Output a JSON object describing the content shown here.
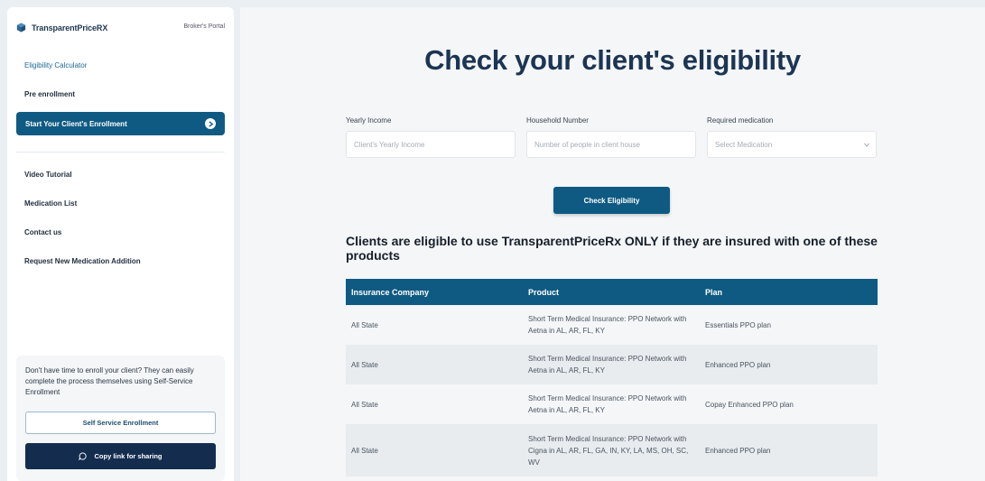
{
  "sidebar": {
    "brand_name": "TransparentPriceRX",
    "portal_label": "Broker's Portal",
    "nav": {
      "eligibility_calculator": "Eligibility Calculator",
      "pre_enrollment": "Pre enrollment",
      "start_enrollment": "Start Your Client's Enrollment",
      "video_tutorial": "Video Tutorial",
      "medication_list": "Medication List",
      "contact_us": "Contact us",
      "request_medication": "Request New Medication Addition"
    },
    "promo": {
      "text": "Don't have time to enroll your client? They can easily complete the process themselves using Self-Service Enrollment",
      "self_service_button": "Self Service Enrollment",
      "copy_link_button": "Copy link for sharing"
    }
  },
  "main": {
    "title": "Check your client's eligibility",
    "fields": {
      "income_label": "Yearly Income",
      "income_placeholder": "Client's Yearly Income",
      "household_label": "Household Number",
      "household_placeholder": "Number of people in client house",
      "medication_label": "Required medication",
      "medication_placeholder": "Select Medication"
    },
    "check_button": "Check Eligibility",
    "note": "Clients are eligible to use TransparentPriceRx ONLY if they are insured with one of these products",
    "table": {
      "headers": [
        "Insurance Company",
        "Product",
        "Plan"
      ],
      "rows": [
        {
          "company": "All State",
          "product": "Short Term Medical Insurance: PPO Network with Aetna in AL, AR, FL, KY",
          "plan": "Essentials PPO plan"
        },
        {
          "company": "All State",
          "product": "Short Term Medical Insurance: PPO Network with Aetna in AL, AR, FL, KY",
          "plan": "Enhanced PPO plan"
        },
        {
          "company": "All State",
          "product": "Short Term Medical Insurance: PPO Network with Aetna in AL, AR, FL, KY",
          "plan": "Copay Enhanced PPO plan"
        },
        {
          "company": "All State",
          "product": "Short Term Medical Insurance: PPO Network with Cigna in AL, AR, FL, GA, IN, KY, LA, MS, OH, SC, WV",
          "plan": "Enhanced PPO plan"
        }
      ]
    }
  },
  "colors": {
    "primary": "#0f5a82",
    "navy": "#142d4f",
    "title": "#1c3553",
    "background": "#e9eff3"
  }
}
